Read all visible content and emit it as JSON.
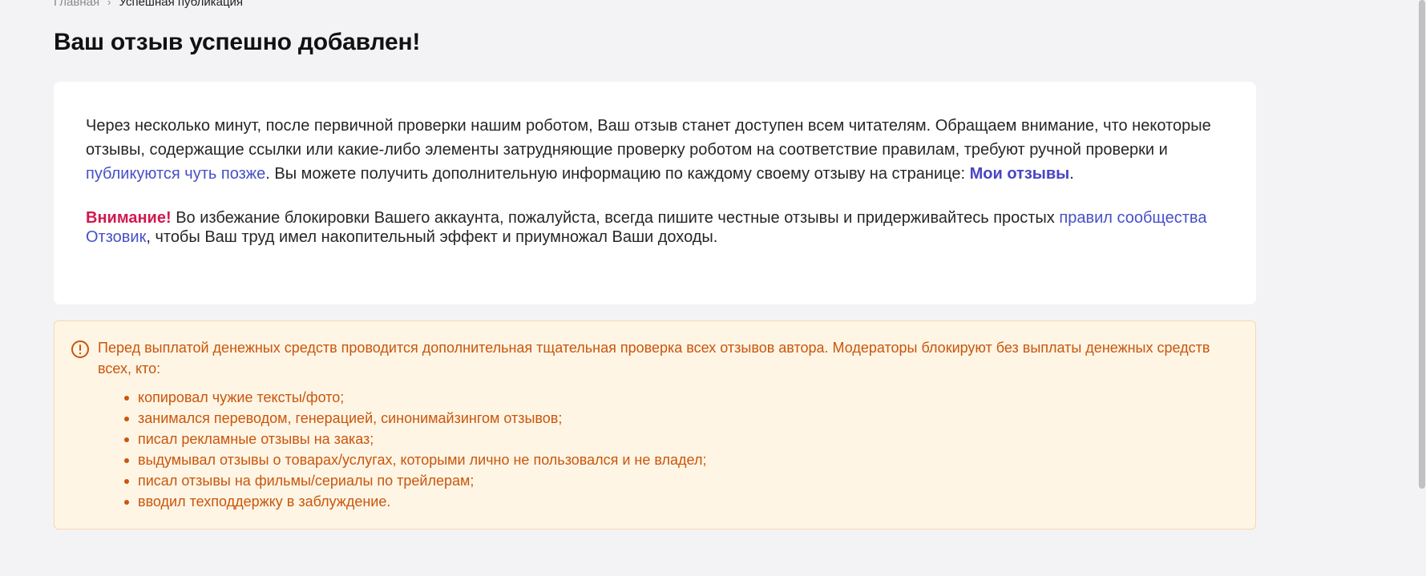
{
  "breadcrumb": {
    "home": "Главная",
    "separator": "›",
    "current": "Успешная публикация"
  },
  "title": "Ваш отзыв успешно добавлен!",
  "card": {
    "intro_part1": "Через несколько минут, после первичной проверки нашим роботом, Ваш отзыв станет доступен всем читателям. Обращаем внимание, что некоторые отзывы, содержащие ссылки или какие-либо элементы затрудняющие проверку роботом на соответствие правилам, требуют ручной проверки и ",
    "intro_link": "публикуются чуть позже",
    "intro_part2": ". Вы можете получить дополнительную информацию по каждому своему отзыву на странице: ",
    "my_reviews_link": "Мои отзывы",
    "intro_end": ".",
    "attention_label": "Внимание!",
    "warning_part1": " Во избежание блокировки Вашего аккаунта, пожалуйста, всегда пишите честные отзывы и придерживайтесь простых ",
    "rules_link": "правил сообщества Отзовик",
    "warning_part2": ", чтобы Ваш труд имел накопительный эффект и приумножал Ваши доходы."
  },
  "alert": {
    "icon": "exclamation-circle-icon",
    "text": "Перед выплатой денежных средств проводится дополнительная тщательная проверка всех отзывов автора. Модераторы блокируют без выплаты денежных средств всех, кто:",
    "items": [
      "копировал чужие тексты/фото;",
      "занимался переводом, генерацией, синонимайзингом отзывов;",
      "писал рекламные отзывы на заказ;",
      "выдумывал отзывы о товарах/услугах, которыми лично не пользовался и не владел;",
      "писал отзывы на фильмы/сериалы по трейлерам;",
      "вводил техподдержку в заблуждение."
    ]
  },
  "colors": {
    "background": "#f3f3f6",
    "link": "#4650c8",
    "attention": "#d0194f",
    "alert_text": "#c9560d",
    "alert_bg": "#fff5e4"
  }
}
